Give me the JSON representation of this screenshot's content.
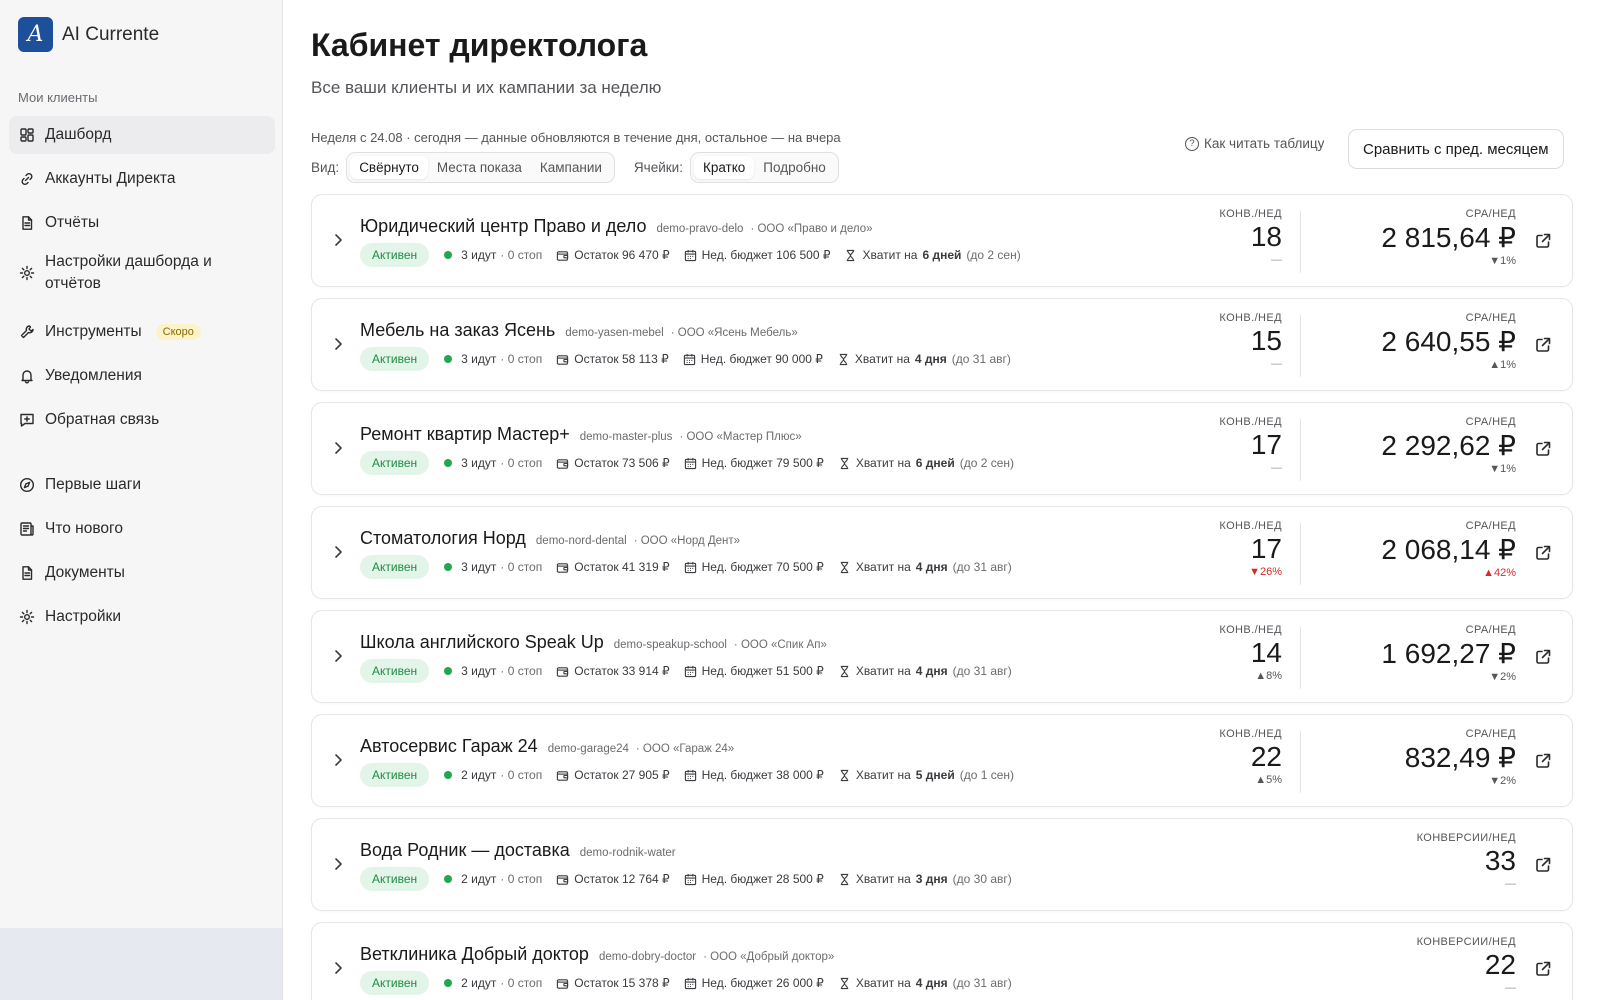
{
  "app": {
    "name": "AI Currente",
    "logo_letter": "A"
  },
  "sidebar": {
    "section_title": "Мои клиенты",
    "items": [
      {
        "label": "Дашборд",
        "icon": "dashboard-icon",
        "active": true
      },
      {
        "label": "Аккаунты Директа",
        "icon": "link-icon"
      },
      {
        "label": "Отчёты",
        "icon": "document-icon"
      },
      {
        "label": "Настройки дашборда и отчётов",
        "icon": "gear-icon"
      },
      {
        "label": "Инструменты",
        "icon": "wrench-icon",
        "badge": "Скоро"
      },
      {
        "label": "Уведомления",
        "icon": "bell-icon"
      },
      {
        "label": "Обратная связь",
        "icon": "feedback-icon"
      },
      {
        "label": "Первые шаги",
        "icon": "compass-icon"
      },
      {
        "label": "Что нового",
        "icon": "news-icon"
      },
      {
        "label": "Документы",
        "icon": "document-icon"
      },
      {
        "label": "Настройки",
        "icon": "gear-icon"
      }
    ]
  },
  "header": {
    "title": "Кабинет директолога",
    "subtitle": "Все ваши клиенты и их кампании за неделю",
    "week_note": "Неделя с 24.08 · сегодня — данные обновляются в течение дня, остальное — на вчера",
    "view_label": "Вид:",
    "view_options": [
      "Свёрнуто",
      "Места показа",
      "Кампании"
    ],
    "view_selected": "Свёрнуто",
    "cells_label": "Ячейки:",
    "cells_options": [
      "Кратко",
      "Подробно"
    ],
    "cells_selected": "Кратко",
    "help_link": "Как читать таблицу",
    "help_icon_glyph": "?",
    "compare_button": "Сравнить с пред. месяцем"
  },
  "colors": {
    "status_active_bg": "#e3f5e8",
    "status_active_text": "#1f8a43",
    "status_dot": "#22a652",
    "delta_bad": "#d22b2b",
    "brand": "#1e4f9a"
  },
  "clients": [
    {
      "name": "Юридический центр Право и дело",
      "login": "demo-pravo-delo",
      "org": "· ООО «Право и дело»",
      "status": "Активен",
      "running": "3 идут",
      "stopped": "· 0 стоп",
      "balance": "Остаток 96 470 ₽",
      "budget": "Нед. бюджет 106 500 ₽",
      "enough_prefix": "Хватит на",
      "enough_days": "6 дней",
      "enough_until": "(до 2 сен)",
      "m1_label": "КОНВ./НЕД",
      "m1_value": "18",
      "m1_delta": "—",
      "m1_delta_kind": "neutral",
      "m2_label": "CPA/НЕД",
      "m2_value": "2 815,64 ₽",
      "m2_delta": "▼1%",
      "m2_delta_kind": "down-neutral"
    },
    {
      "name": "Мебель на заказ Ясень",
      "login": "demo-yasen-mebel",
      "org": "· ООО «Ясень Мебель»",
      "status": "Активен",
      "running": "3 идут",
      "stopped": "· 0 стоп",
      "balance": "Остаток 58 113 ₽",
      "budget": "Нед. бюджет 90 000 ₽",
      "enough_prefix": "Хватит на",
      "enough_days": "4 дня",
      "enough_until": "(до 31 авг)",
      "m1_label": "КОНВ./НЕД",
      "m1_value": "15",
      "m1_delta": "—",
      "m1_delta_kind": "neutral",
      "m2_label": "CPA/НЕД",
      "m2_value": "2 640,55 ₽",
      "m2_delta": "▲1%",
      "m2_delta_kind": "up-neutral"
    },
    {
      "name": "Ремонт квартир Мастер+",
      "login": "demo-master-plus",
      "org": "· ООО «Мастер Плюс»",
      "status": "Активен",
      "running": "3 идут",
      "stopped": "· 0 стоп",
      "balance": "Остаток 73 506 ₽",
      "budget": "Нед. бюджет 79 500 ₽",
      "enough_prefix": "Хватит на",
      "enough_days": "6 дней",
      "enough_until": "(до 2 сен)",
      "m1_label": "КОНВ./НЕД",
      "m1_value": "17",
      "m1_delta": "—",
      "m1_delta_kind": "neutral",
      "m2_label": "CPA/НЕД",
      "m2_value": "2 292,62 ₽",
      "m2_delta": "▼1%",
      "m2_delta_kind": "down-neutral"
    },
    {
      "name": "Стоматология Норд",
      "login": "demo-nord-dental",
      "org": "· ООО «Норд Дент»",
      "status": "Активен",
      "running": "3 идут",
      "stopped": "· 0 стоп",
      "balance": "Остаток 41 319 ₽",
      "budget": "Нед. бюджет 70 500 ₽",
      "enough_prefix": "Хватит на",
      "enough_days": "4 дня",
      "enough_until": "(до 31 авг)",
      "m1_label": "КОНВ./НЕД",
      "m1_value": "17",
      "m1_delta": "▼26%",
      "m1_delta_kind": "bad",
      "m2_label": "CPA/НЕД",
      "m2_value": "2 068,14 ₽",
      "m2_delta": "▲42%",
      "m2_delta_kind": "bad"
    },
    {
      "name": "Школа английского Speak Up",
      "login": "demo-speakup-school",
      "org": "· ООО «Спик Ап»",
      "status": "Активен",
      "running": "3 идут",
      "stopped": "· 0 стоп",
      "balance": "Остаток 33 914 ₽",
      "budget": "Нед. бюджет 51 500 ₽",
      "enough_prefix": "Хватит на",
      "enough_days": "4 дня",
      "enough_until": "(до 31 авг)",
      "m1_label": "КОНВ./НЕД",
      "m1_value": "14",
      "m1_delta": "▲8%",
      "m1_delta_kind": "up-neutral",
      "m2_label": "CPA/НЕД",
      "m2_value": "1 692,27 ₽",
      "m2_delta": "▼2%",
      "m2_delta_kind": "down-neutral"
    },
    {
      "name": "Автосервис Гараж 24",
      "login": "demo-garage24",
      "org": "· ООО «Гараж 24»",
      "status": "Активен",
      "running": "2 идут",
      "stopped": "· 0 стоп",
      "balance": "Остаток 27 905 ₽",
      "budget": "Нед. бюджет 38 000 ₽",
      "enough_prefix": "Хватит на",
      "enough_days": "5 дней",
      "enough_until": "(до 1 сен)",
      "m1_label": "КОНВ./НЕД",
      "m1_value": "22",
      "m1_delta": "▲5%",
      "m1_delta_kind": "up-neutral",
      "m2_label": "CPA/НЕД",
      "m2_value": "832,49 ₽",
      "m2_delta": "▼2%",
      "m2_delta_kind": "down-neutral"
    },
    {
      "name": "Вода Родник — доставка",
      "login": "demo-rodnik-water",
      "org": "",
      "status": "Активен",
      "running": "2 идут",
      "stopped": "· 0 стоп",
      "balance": "Остаток 12 764 ₽",
      "budget": "Нед. бюджет 28 500 ₽",
      "enough_prefix": "Хватит на",
      "enough_days": "3 дня",
      "enough_until": "(до 30 авг)",
      "m2_label": "КОНВЕРСИИ/НЕД",
      "m2_value": "33",
      "m2_delta": "—",
      "m2_delta_kind": "neutral"
    },
    {
      "name": "Ветклиника Добрый доктор",
      "login": "demo-dobry-doctor",
      "org": "· ООО «Добрый доктор»",
      "status": "Активен",
      "running": "2 идут",
      "stopped": "· 0 стоп",
      "balance": "Остаток 15 378 ₽",
      "budget": "Нед. бюджет 26 000 ₽",
      "enough_prefix": "Хватит на",
      "enough_days": "4 дня",
      "enough_until": "(до 31 авг)",
      "m2_label": "КОНВЕРСИИ/НЕД",
      "m2_value": "22",
      "m2_delta": "—",
      "m2_delta_kind": "neutral"
    }
  ]
}
